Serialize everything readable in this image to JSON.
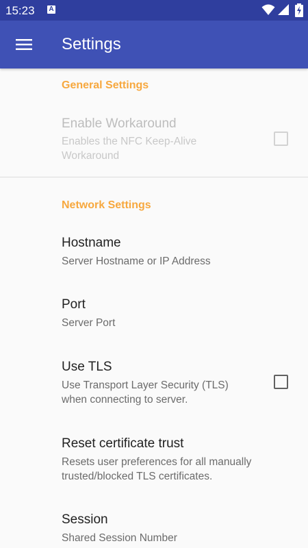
{
  "status_bar": {
    "time": "15:23",
    "notification_letter": "A",
    "icons": [
      "wifi-icon",
      "signal-icon",
      "battery-charging-icon"
    ]
  },
  "app_bar": {
    "title": "Settings",
    "menu_icon": "hamburger-menu-icon"
  },
  "colors": {
    "status_bar": "#2f3e9e",
    "app_bar": "#3f51b5",
    "category": "#f7a83e"
  },
  "sections": {
    "general": {
      "title": "General Settings",
      "enable_workaround": {
        "title": "Enable Workaround",
        "summary": "Enables the NFC Keep-Alive Workaround",
        "checked": false,
        "enabled": false
      }
    },
    "network": {
      "title": "Network Settings",
      "hostname": {
        "title": "Hostname",
        "summary": "Server Hostname or IP Address"
      },
      "port": {
        "title": "Port",
        "summary": "Server Port"
      },
      "use_tls": {
        "title": "Use TLS",
        "summary": "Use Transport Layer Security (TLS) when connecting to server.",
        "checked": false
      },
      "reset_trust": {
        "title": "Reset certificate trust",
        "summary": "Resets user preferences for all manually trusted/blocked TLS certificates."
      },
      "session": {
        "title": "Session",
        "summary": "Shared Session Number"
      }
    }
  }
}
